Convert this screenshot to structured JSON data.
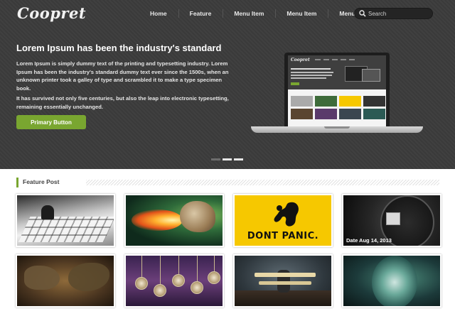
{
  "header": {
    "logo": "Coopret",
    "nav": [
      "Home",
      "Feature",
      "Menu Item",
      "Menu Item",
      "Menu Item"
    ],
    "search": {
      "placeholder": "Search"
    }
  },
  "hero": {
    "title": "Lorem Ipsum has been the industry's standard",
    "paragraph1": "Lorem Ipsum is simply dummy text of the printing and typesetting industry. Lorem Ipsum has been the industry's standard dummy text ever since the 1500s, when an unknown printer took a galley of type and scrambled it to make a type specimen book.",
    "paragraph2": "It has survived not only five centuries, but also the leap into electronic typesetting, remaining essentially unchanged.",
    "button_label": "Primary Button",
    "slider": {
      "count": 3,
      "active": 1
    }
  },
  "feature": {
    "heading": "Feature Post",
    "posts": [
      {
        "image": "keyboard-photo"
      },
      {
        "image": "fire-cat-photo"
      },
      {
        "image": "dont-panic-poster",
        "poster_text": "DONT PANIC."
      },
      {
        "image": "clock-photo",
        "date": "Date Aug 14, 2013"
      },
      {
        "image": "map-photo"
      },
      {
        "image": "pocket-watches-photo"
      },
      {
        "image": "toy-plane-photo"
      },
      {
        "image": "lion-photo"
      }
    ]
  },
  "colors": {
    "accent_green": "#79a630",
    "hero_bg": "#3b3b3b",
    "poster_yellow": "#f6c800"
  }
}
